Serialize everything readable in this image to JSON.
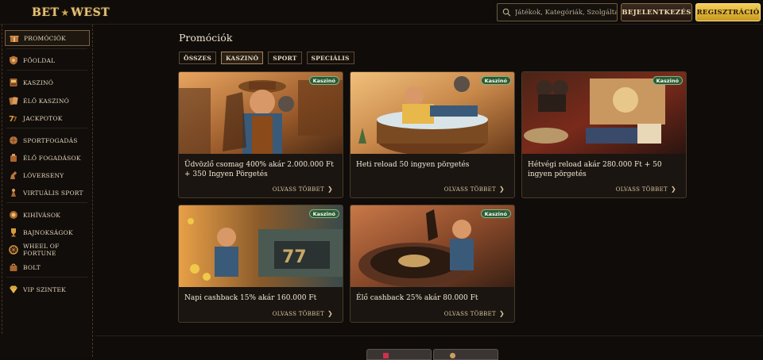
{
  "header": {
    "logo_part1": "BET",
    "logo_part2": "WEST",
    "search_placeholder": "Játékok, Kategóriák, Szolgáltatók",
    "login_label": "BEJELENTKEZÉS",
    "register_label": "REGISZTRÁCIÓ"
  },
  "sidebar": {
    "items": [
      {
        "label": "PROMÓCIÓK",
        "icon": "gift-icon",
        "active": true
      },
      {
        "label": "FŐOLDAL",
        "icon": "shield-icon"
      },
      {
        "label": "KASZINÓ",
        "icon": "casino-icon"
      },
      {
        "label": "ÉLŐ KASZINÓ",
        "icon": "cards-icon"
      },
      {
        "label": "JACKPOTOK",
        "icon": "jackpot-icon"
      },
      {
        "label": "SPORTFOGADÁS",
        "icon": "ball-icon"
      },
      {
        "label": "ÉLŐ FOGADÁSOK",
        "icon": "live-bet-icon"
      },
      {
        "label": "LÓVERSENY",
        "icon": "horse-icon"
      },
      {
        "label": "VIRTUÁLIS SPORT",
        "icon": "virtual-icon"
      },
      {
        "label": "KIHÍVÁSOK",
        "icon": "challenge-icon"
      },
      {
        "label": "BAJNOKSÁGOK",
        "icon": "trophy-icon"
      },
      {
        "label": "WHEEL OF FORTUNE",
        "icon": "wheel-icon"
      },
      {
        "label": "BOLT",
        "icon": "shop-icon"
      },
      {
        "label": "VIP SZINTEK",
        "icon": "diamond-icon"
      }
    ]
  },
  "main": {
    "title": "Promóciók",
    "tabs": [
      {
        "label": "ÖSSZES"
      },
      {
        "label": "KASZINÓ",
        "active": true
      },
      {
        "label": "SPORT"
      },
      {
        "label": "SPECIÁLIS"
      }
    ],
    "cards": [
      {
        "badge": "Kaszinó",
        "title": "Üdvözlő csomag 400% akár 2.000.000 Ft + 350 Ingyen Pörgetés",
        "more": "OLVASS TÖBBET"
      },
      {
        "badge": "Kaszinó",
        "title": "Heti reload 50 ingyen pörgetés",
        "more": "OLVASS TÖBBET"
      },
      {
        "badge": "Kaszinó",
        "title": "Hétvégi reload akár 280.000 Ft + 50 ingyen pörgetés",
        "more": "OLVASS TÖBBET"
      },
      {
        "badge": "Kaszinó",
        "title": "Napi cashback 15% akár 160.000 Ft",
        "more": "OLVASS TÖBBET"
      },
      {
        "badge": "Kaszinó",
        "title": "Élő cashback 25% akár 80.000 Ft",
        "more": "OLVASS TÖBBET"
      }
    ]
  },
  "colors": {
    "accent_gold": "#d4a94f",
    "badge_green": "#2f5a35",
    "background": "#0f0c0a"
  }
}
